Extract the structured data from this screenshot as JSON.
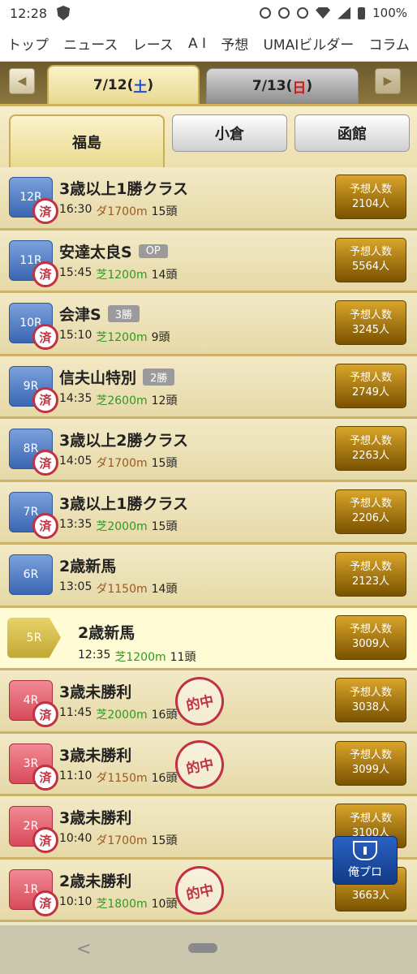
{
  "status": {
    "time": "12:28",
    "battery": "100%"
  },
  "nav": [
    "トップ",
    "ニュース",
    "レース",
    "A I",
    "予想",
    "UMAIビルダー",
    "コラム"
  ],
  "date_tabs": [
    {
      "date": "7/12",
      "day": "土",
      "active": true
    },
    {
      "date": "7/13",
      "day": "日",
      "active": false
    }
  ],
  "venues": [
    {
      "label": "福島",
      "active": true
    },
    {
      "label": "小倉",
      "active": false
    },
    {
      "label": "函館",
      "active": false
    }
  ],
  "races": [
    {
      "num": "12R",
      "name": "3歳以上1勝クラス",
      "time": "16:30",
      "surface": "ダ1700m",
      "surface_type": "dirt",
      "heads": "15頭",
      "grade": "",
      "count_label": "予想人数",
      "count": "2104人",
      "done": "済",
      "hit": ""
    },
    {
      "num": "11R",
      "name": "安達太良S",
      "time": "15:45",
      "surface": "芝1200m",
      "surface_type": "turf",
      "heads": "14頭",
      "grade": "OP",
      "count_label": "予想人数",
      "count": "5564人",
      "done": "済",
      "hit": ""
    },
    {
      "num": "10R",
      "name": "会津S",
      "time": "15:10",
      "surface": "芝1200m",
      "surface_type": "turf",
      "heads": "9頭",
      "grade": "3勝",
      "count_label": "予想人数",
      "count": "3245人",
      "done": "済",
      "hit": ""
    },
    {
      "num": "9R",
      "name": "信夫山特別",
      "time": "14:35",
      "surface": "芝2600m",
      "surface_type": "turf",
      "heads": "12頭",
      "grade": "2勝",
      "count_label": "予想人数",
      "count": "2749人",
      "done": "済",
      "hit": ""
    },
    {
      "num": "8R",
      "name": "3歳以上2勝クラス",
      "time": "14:05",
      "surface": "ダ1700m",
      "surface_type": "dirt",
      "heads": "15頭",
      "grade": "",
      "count_label": "予想人数",
      "count": "2263人",
      "done": "済",
      "hit": ""
    },
    {
      "num": "7R",
      "name": "3歳以上1勝クラス",
      "time": "13:35",
      "surface": "芝2000m",
      "surface_type": "turf",
      "heads": "15頭",
      "grade": "",
      "count_label": "予想人数",
      "count": "2206人",
      "done": "済",
      "hit": ""
    },
    {
      "num": "6R",
      "name": "2歳新馬",
      "time": "13:05",
      "surface": "ダ1150m",
      "surface_type": "dirt",
      "heads": "14頭",
      "grade": "",
      "count_label": "予想人数",
      "count": "2123人",
      "done": "",
      "hit": ""
    },
    {
      "num": "5R",
      "name": "2歳新馬",
      "time": "12:35",
      "surface": "芝1200m",
      "surface_type": "turf",
      "heads": "11頭",
      "grade": "",
      "count_label": "予想人数",
      "count": "3009人",
      "done": "",
      "hit": "",
      "current": true
    },
    {
      "num": "4R",
      "name": "3歳未勝利",
      "time": "11:45",
      "surface": "芝2000m",
      "surface_type": "turf",
      "heads": "16頭",
      "grade": "",
      "count_label": "予想人数",
      "count": "3038人",
      "done": "済",
      "hit": "的中"
    },
    {
      "num": "3R",
      "name": "3歳未勝利",
      "time": "11:10",
      "surface": "ダ1150m",
      "surface_type": "dirt",
      "heads": "16頭",
      "grade": "",
      "count_label": "予想人数",
      "count": "3099人",
      "done": "済",
      "hit": "的中"
    },
    {
      "num": "2R",
      "name": "3歳未勝利",
      "time": "10:40",
      "surface": "ダ1700m",
      "surface_type": "dirt",
      "heads": "15頭",
      "grade": "",
      "count_label": "予想人数",
      "count": "3100人",
      "done": "済",
      "hit": ""
    },
    {
      "num": "1R",
      "name": "2歳未勝利",
      "time": "10:10",
      "surface": "芝1800m",
      "surface_type": "turf",
      "heads": "10頭",
      "grade": "",
      "count_label": "予想人数",
      "count": "3663人",
      "done": "済",
      "hit": "的中"
    }
  ],
  "fab": {
    "label": "俺プロ",
    "icon": "trophy-icon"
  },
  "colors": {
    "turf": "#2e9a21",
    "dirt": "#9a5a20",
    "gold": "#c9ae57",
    "blue_badge": "#3a66b3",
    "red_badge": "#d84a5a"
  }
}
